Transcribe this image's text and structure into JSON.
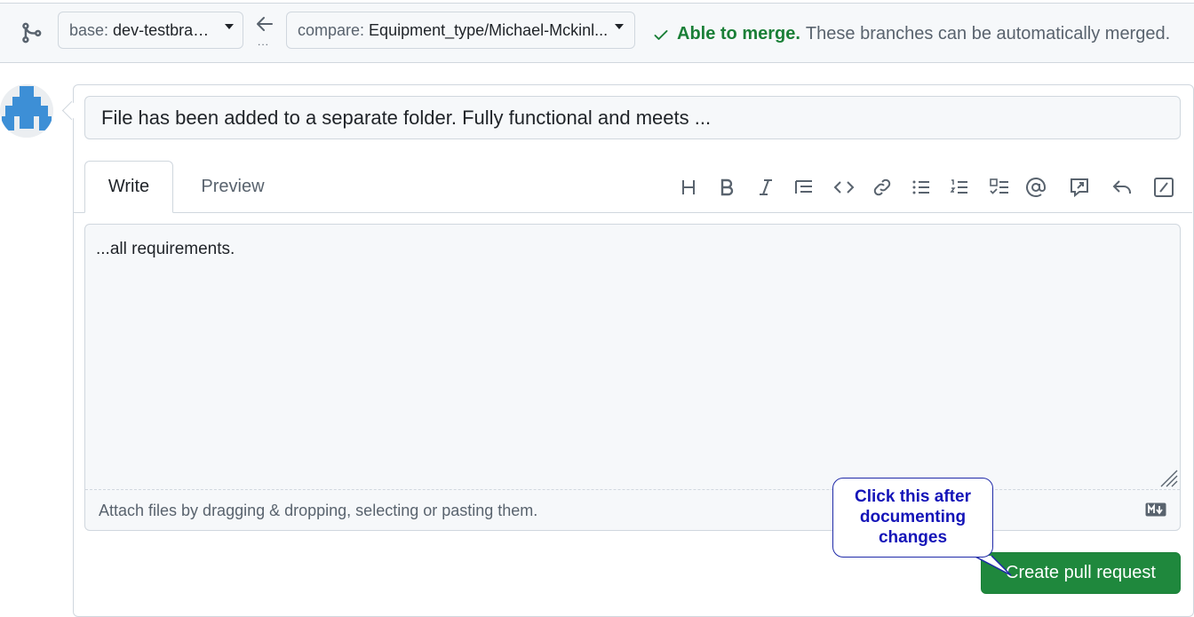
{
  "header": {
    "base_label": "base:",
    "base_branch": "dev-testbranch",
    "compare_label": "compare:",
    "compare_branch": "Equipment_type/Michael-Mckinl...",
    "arrow_dots": "...",
    "merge_status": "Able to merge.",
    "merge_description": "These branches can be automatically merged."
  },
  "form": {
    "title_value": "File has been added to a separate folder. Fully functional and meets ...",
    "tabs": [
      "Write",
      "Preview"
    ],
    "active_tab": "Write",
    "body_value": "...all requirements.",
    "attach_hint": "Attach files by dragging & dropping, selecting or pasting them."
  },
  "toolbar": {
    "icons": [
      "heading-icon",
      "bold-icon",
      "italic-icon",
      "quote-icon",
      "code-icon",
      "link-icon",
      "bulleted-list-icon",
      "numbered-list-icon",
      "task-list-icon",
      "mention-icon",
      "reference-icon",
      "reply-icon",
      "slash-commands-icon"
    ]
  },
  "actions": {
    "create_label": "Create pull request"
  },
  "annotation": {
    "callout_line1": "Click this after",
    "callout_line2": "documenting",
    "callout_line3": "changes"
  },
  "colors": {
    "success": "#1a7f37",
    "button": "#1f883d",
    "callout_text": "#1414b8",
    "callout_border": "#1f2aa8"
  }
}
